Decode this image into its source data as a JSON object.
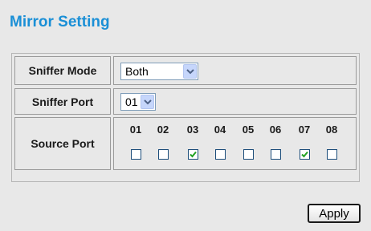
{
  "title": "Mirror Setting",
  "sniffer_mode": {
    "label": "Sniffer Mode",
    "value": "Both"
  },
  "sniffer_port": {
    "label": "Sniffer Port",
    "value": "01"
  },
  "source_port": {
    "label": "Source Port",
    "ports": [
      {
        "number": "01",
        "checked": false
      },
      {
        "number": "02",
        "checked": false
      },
      {
        "number": "03",
        "checked": true
      },
      {
        "number": "04",
        "checked": false
      },
      {
        "number": "05",
        "checked": false
      },
      {
        "number": "06",
        "checked": false
      },
      {
        "number": "07",
        "checked": true
      },
      {
        "number": "08",
        "checked": false
      }
    ]
  },
  "buttons": {
    "apply": "Apply"
  },
  "icons": {
    "dropdown": "chevron-down-icon",
    "check": "checkmark-icon"
  },
  "colors": {
    "title": "#1a8fd6",
    "check": "#21a121"
  }
}
